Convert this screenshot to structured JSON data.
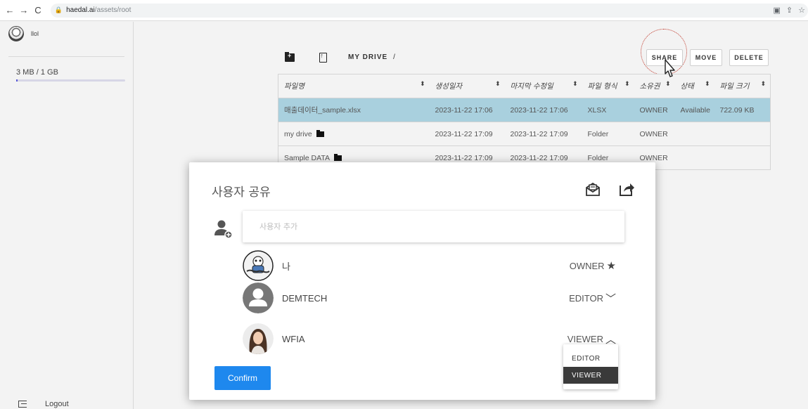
{
  "browser": {
    "url_host": "haedal.ai",
    "url_path": "/assets/root"
  },
  "sidebar": {
    "username": "llol",
    "storage": "3 MB / 1 GB",
    "storage_fraction": 0.003,
    "logout": "Logout"
  },
  "toolbar": {
    "breadcrumb": "MY DRIVE",
    "breadcrumb_sep": "/",
    "share": "SHARE",
    "move": "MOVE",
    "delete": "DELETE"
  },
  "table": {
    "columns": [
      "파일명",
      "생성일자",
      "마지막 수정일",
      "파일 형식",
      "소유권",
      "상태",
      "파일 크기"
    ],
    "rows": [
      {
        "name": "매출데이터_sample.xlsx",
        "created": "2023-11-22 17:06",
        "modified": "2023-11-22 17:06",
        "type": "XLSX",
        "owner": "OWNER",
        "status": "Available",
        "size": "722.09 KB",
        "folder": false,
        "selected": true
      },
      {
        "name": "my drive",
        "created": "2023-11-22 17:09",
        "modified": "2023-11-22 17:09",
        "type": "Folder",
        "owner": "OWNER",
        "status": "",
        "size": "",
        "folder": true,
        "selected": false
      },
      {
        "name": "Sample DATA",
        "created": "2023-11-22 17:09",
        "modified": "2023-11-22 17:09",
        "type": "Folder",
        "owner": "OWNER",
        "status": "",
        "size": "",
        "folder": true,
        "selected": false
      }
    ]
  },
  "modal": {
    "title": "사용자 공유",
    "input_placeholder": "사용자 추가",
    "members": [
      {
        "name": "나",
        "role": "OWNER",
        "role_icon": "star-icon",
        "avatar": "robot"
      },
      {
        "name": "DEMTECH",
        "role": "EDITOR",
        "role_icon": "chevron-down-icon",
        "avatar": "default"
      },
      {
        "name": "WFIA",
        "role": "VIEWER",
        "role_icon": "chevron-up-icon",
        "avatar": "woman"
      }
    ],
    "confirm": "Confirm",
    "dropdown_options": [
      "EDITOR",
      "VIEWER"
    ],
    "dropdown_selected": "VIEWER"
  }
}
